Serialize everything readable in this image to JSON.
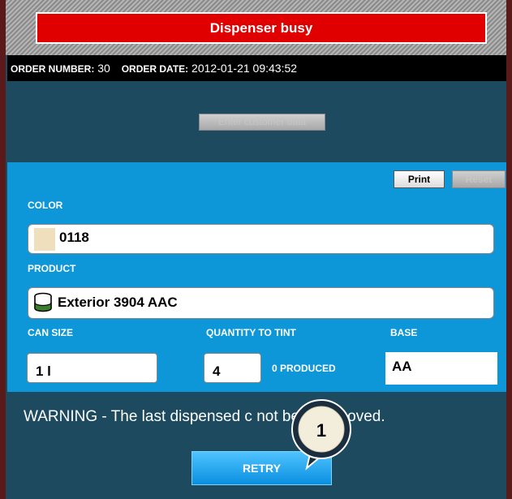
{
  "banner": {
    "text": "Dispenser busy"
  },
  "order": {
    "number_label": "ORDER NUMBER:",
    "number_value": "30",
    "date_label": "ORDER DATE:",
    "date_value": "2012-01-21 09:43:52"
  },
  "customer": {
    "enter_button": "Enter customer data"
  },
  "toolbar": {
    "print_label": "Print",
    "reset_label": "Reset"
  },
  "color": {
    "label": "COLOR",
    "value": "0118",
    "swatch_color": "#efdfbd"
  },
  "product": {
    "label": "PRODUCT",
    "value": "Exterior 3904 AAC",
    "icon": "paint-can-icon"
  },
  "can_size": {
    "label": "CAN SIZE",
    "value": "1 l"
  },
  "quantity": {
    "label": "QUANTITY TO TINT",
    "value": "4",
    "produced": "0 PRODUCED"
  },
  "base": {
    "label": "BASE",
    "value": "AA"
  },
  "warning": {
    "text": "WARNING - The last dispensed c                not been removed."
  },
  "retry_button": "RETRY",
  "callout": {
    "number": "1"
  }
}
